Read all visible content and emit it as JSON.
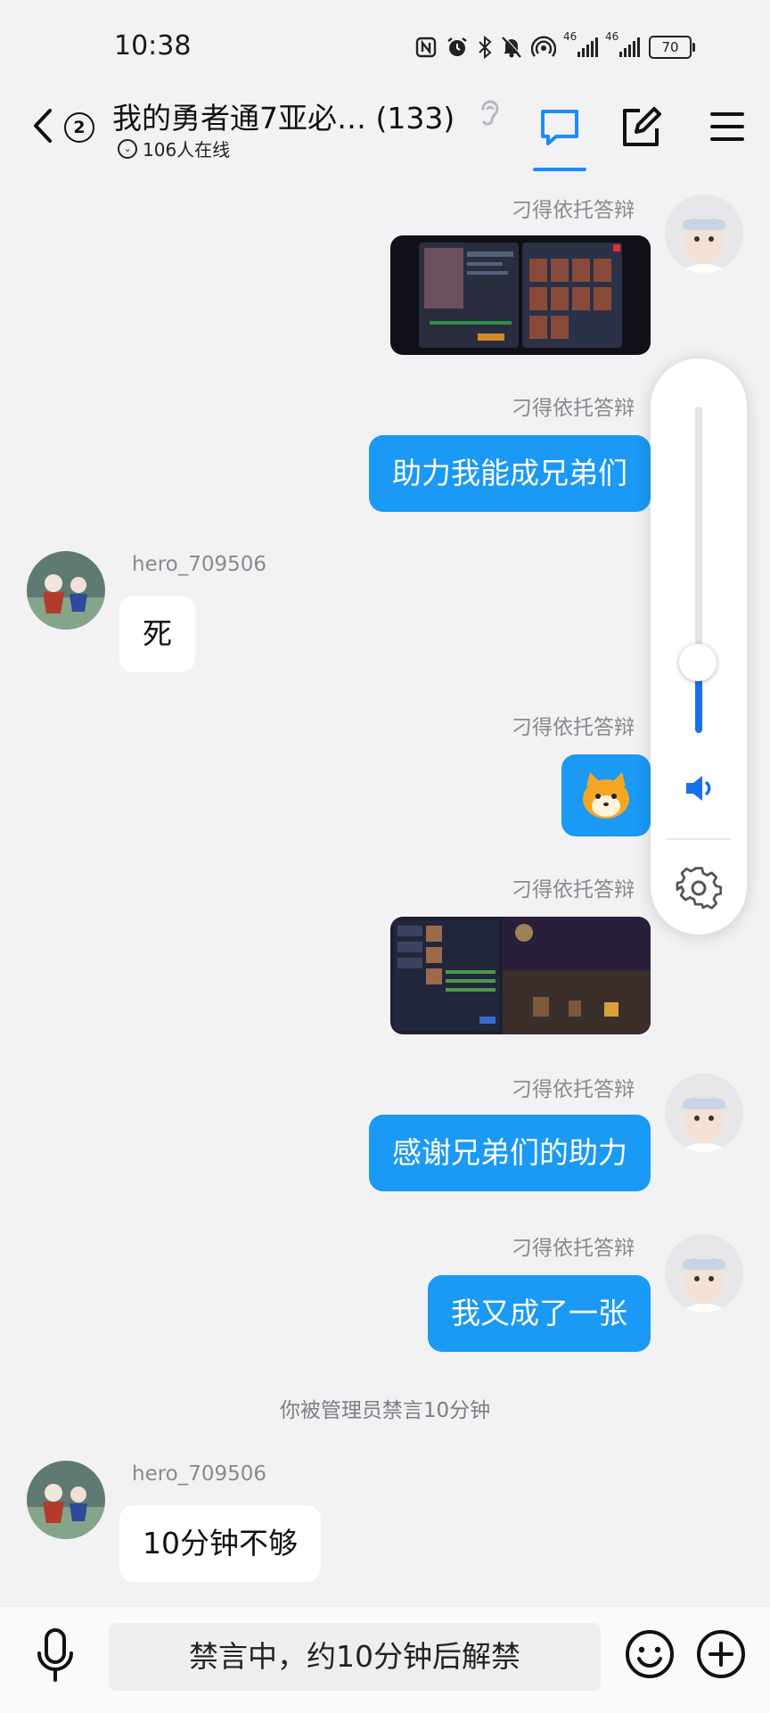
{
  "status_bar": {
    "time": "10:38",
    "signal1_label": "46",
    "signal2_label": "46",
    "battery": "70"
  },
  "header": {
    "unread_count": "2",
    "title": "我的勇者通7亚必… (133)",
    "online": "106人在线"
  },
  "messages": [
    {
      "sender": "刁得依托答辩",
      "type": "image"
    },
    {
      "sender": "刁得依托答辩",
      "text": "助力我能成兄弟们"
    },
    {
      "sender": "hero_709506",
      "text": "死"
    },
    {
      "sender": "刁得依托答辩",
      "type": "sticker"
    },
    {
      "sender": "刁得依托答辩",
      "type": "image"
    },
    {
      "sender": "刁得依托答辩",
      "text": "感谢兄弟们的助力"
    },
    {
      "sender": "刁得依托答辩",
      "text": "我又成了一张"
    },
    {
      "sender": "hero_709506",
      "text": "10分钟不够"
    }
  ],
  "system_message": "你被管理员禁言10分钟",
  "input": {
    "muted_text": "禁言中，约10分钟后解禁"
  },
  "volume_panel": {
    "level": 0.2
  },
  "colors": {
    "accent": "#1a99f5",
    "background": "#f2f2f4"
  },
  "icons": [
    "back-icon",
    "chat-icon",
    "edit-icon",
    "menu-icon",
    "ear-icon",
    "speaker-icon",
    "gear-icon",
    "mic-icon",
    "emoji-icon",
    "plus-icon"
  ]
}
